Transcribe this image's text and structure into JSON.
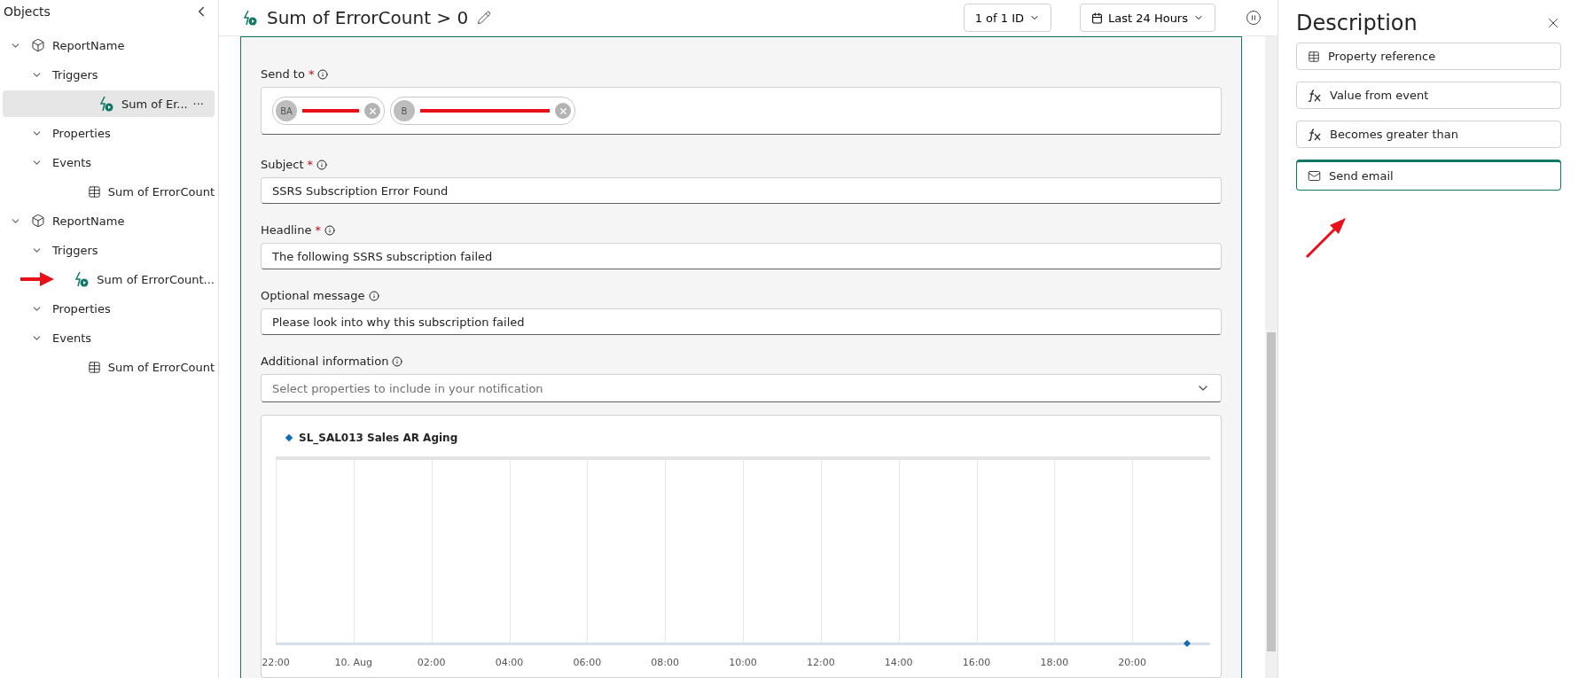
{
  "sidebar": {
    "title": "Objects",
    "tree": [
      {
        "label": "ReportName",
        "kind": "object",
        "expanded": true,
        "selected": false,
        "children": [
          {
            "label": "Triggers",
            "kind": "group",
            "expanded": true,
            "selected": false,
            "children": [
              {
                "label": "Sum of Er...",
                "kind": "trigger",
                "selected": true,
                "more": "···"
              }
            ]
          },
          {
            "label": "Properties",
            "kind": "group",
            "expanded": true,
            "selected": false
          },
          {
            "label": "Events",
            "kind": "group",
            "expanded": true,
            "selected": false,
            "children": [
              {
                "label": "Sum of ErrorCount",
                "kind": "event",
                "selected": false
              }
            ]
          }
        ]
      },
      {
        "label": "ReportName",
        "kind": "object",
        "expanded": true,
        "selected": false,
        "children": [
          {
            "label": "Triggers",
            "kind": "group",
            "expanded": true,
            "selected": false,
            "children": [
              {
                "label": "Sum of ErrorCount...",
                "kind": "trigger",
                "selected": false,
                "pointed": true
              }
            ]
          },
          {
            "label": "Properties",
            "kind": "group",
            "expanded": true,
            "selected": false
          },
          {
            "label": "Events",
            "kind": "group",
            "expanded": true,
            "selected": false,
            "children": [
              {
                "label": "Sum of ErrorCount",
                "kind": "event",
                "selected": false
              }
            ]
          }
        ]
      }
    ]
  },
  "header": {
    "title": "Sum of ErrorCount > 0",
    "id_picker": "1 of 1 ID",
    "range_picker": "Last 24 Hours"
  },
  "form": {
    "required_mark": "*",
    "send_to": {
      "label": "Send to",
      "required": true,
      "recipients": [
        {
          "initials": "BA"
        },
        {
          "initials": "B"
        }
      ]
    },
    "fields": [
      {
        "label": "Subject",
        "required": true,
        "kind": "text",
        "value": "SSRS Subscription Error Found"
      },
      {
        "label": "Headline",
        "required": true,
        "kind": "text",
        "value": "The following SSRS subscription failed"
      },
      {
        "label": "Optional message",
        "required": false,
        "kind": "text",
        "value": "Please look into why this subscription failed"
      },
      {
        "label": "Additional information",
        "required": false,
        "kind": "select",
        "placeholder": "Select properties to include in your notification"
      }
    ],
    "chart": {
      "legend": "SL_SAL013 Sales AR Aging",
      "x_labels": [
        "22:00",
        "10. Aug",
        "02:00",
        "04:00",
        "06:00",
        "08:00",
        "10:00",
        "12:00",
        "14:00",
        "16:00",
        "18:00",
        "20:00"
      ]
    }
  },
  "description": {
    "title": "Description",
    "items": [
      {
        "label": "Property reference",
        "kind": "table",
        "selected": false
      },
      {
        "label": "Value from event",
        "kind": "function",
        "selected": false
      },
      {
        "label": "Becomes greater than",
        "kind": "function",
        "selected": false
      },
      {
        "label": "Send email",
        "kind": "mail",
        "selected": true,
        "pointed": true
      }
    ]
  }
}
